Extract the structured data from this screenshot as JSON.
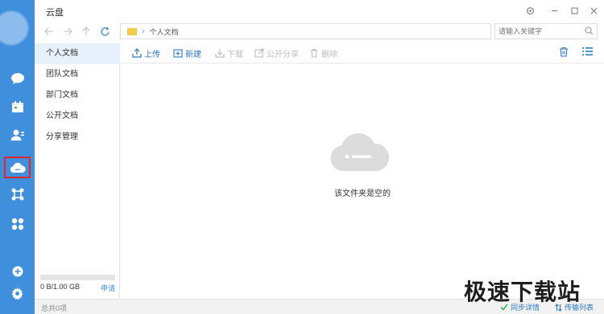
{
  "app": {
    "title": "云盘"
  },
  "nav": {
    "breadcrumb": "个人文档",
    "search_placeholder": "请输入关键字"
  },
  "sidebar": {
    "items": [
      {
        "label": "个人文档",
        "active": true
      },
      {
        "label": "团队文档",
        "active": false
      },
      {
        "label": "部门文档",
        "active": false
      },
      {
        "label": "公开文档",
        "active": false
      },
      {
        "label": "分享管理",
        "active": false
      }
    ],
    "storage": {
      "usage": "0 B/1.00 GB",
      "upgrade_label": "申请",
      "used_fraction": 0
    }
  },
  "toolbar": {
    "upload": "上传",
    "new": "新建",
    "download": "下载",
    "share": "公开分享",
    "delete": "删除"
  },
  "main": {
    "empty_message": "该文件夹是空的"
  },
  "status": {
    "item_count": "总共0项",
    "sync_details": "同步详情",
    "transfer_list": "传输列表"
  },
  "watermark": {
    "text": "极速下载站"
  },
  "colors": {
    "rail": "#3f8fdd",
    "accent": "#2d77c6",
    "highlight": "#e0262b",
    "selected_row": "#e7f1fb"
  },
  "icons": {
    "rail": [
      "chat-icon",
      "calendar-icon",
      "contacts-icon",
      "cloud-drive-icon",
      "apps-hub-icon",
      "grid-apps-icon",
      "add-icon",
      "settings-icon"
    ]
  }
}
